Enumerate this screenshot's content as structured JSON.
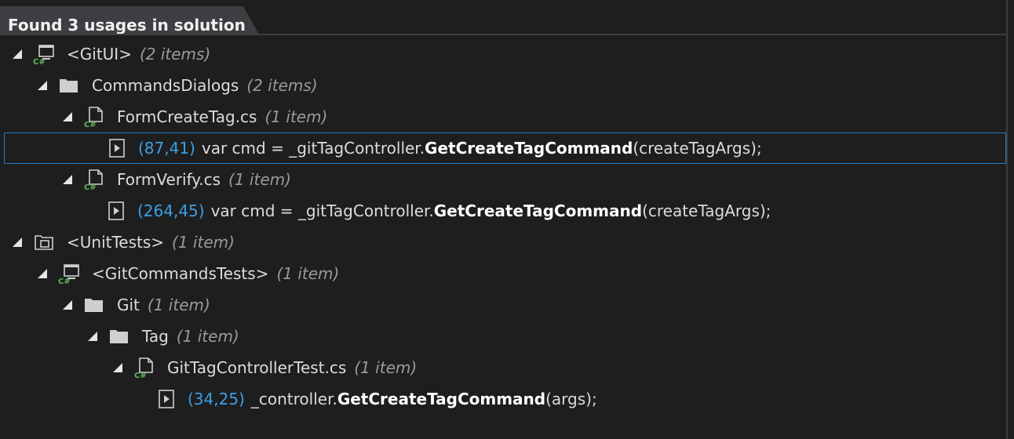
{
  "header": {
    "title": "Found 3 usages in solution"
  },
  "tree": {
    "gitui": {
      "label": "<GitUI>",
      "count": "(2 items)"
    },
    "commands_dialogs": {
      "label": "CommandsDialogs",
      "count": "(2 items)"
    },
    "form_create_tag": {
      "label": "FormCreateTag.cs",
      "count": "(1 item)"
    },
    "usage_1": {
      "pos": "(87,41)",
      "pre": "var cmd = _gitTagController.",
      "method": "GetCreateTagCommand",
      "post": "(createTagArgs);"
    },
    "form_verify": {
      "label": "FormVerify.cs",
      "count": "(1 item)"
    },
    "usage_2": {
      "pos": "(264,45)",
      "pre": "var cmd = _gitTagController.",
      "method": "GetCreateTagCommand",
      "post": "(createTagArgs);"
    },
    "unit_tests": {
      "label": "<UnitTests>",
      "count": "(1 item)"
    },
    "git_commands_tests": {
      "label": "<GitCommandsTests>",
      "count": "(1 item)"
    },
    "git_folder": {
      "label": "Git",
      "count": "(1 item)"
    },
    "tag_folder": {
      "label": "Tag",
      "count": "(1 item)"
    },
    "git_tag_controller_test": {
      "label": "GitTagControllerTest.cs",
      "count": "(1 item)"
    },
    "usage_3": {
      "pos": "(34,25)",
      "pre": "_controller.",
      "method": "GetCreateTagCommand",
      "post": "(args);"
    }
  },
  "colors": {
    "background": "#1e1e1e",
    "tab": "#3e3e42",
    "position": "#3aa0e6",
    "selection_border": "#1f7bcf",
    "csharp_green": "#5fb75f"
  },
  "icons": {
    "project": "csharp-project-icon",
    "folder": "folder-icon",
    "file": "csharp-file-icon",
    "usage": "usage-icon",
    "solution_folder": "solution-folder-icon",
    "expand": "expand-arrow-icon"
  }
}
